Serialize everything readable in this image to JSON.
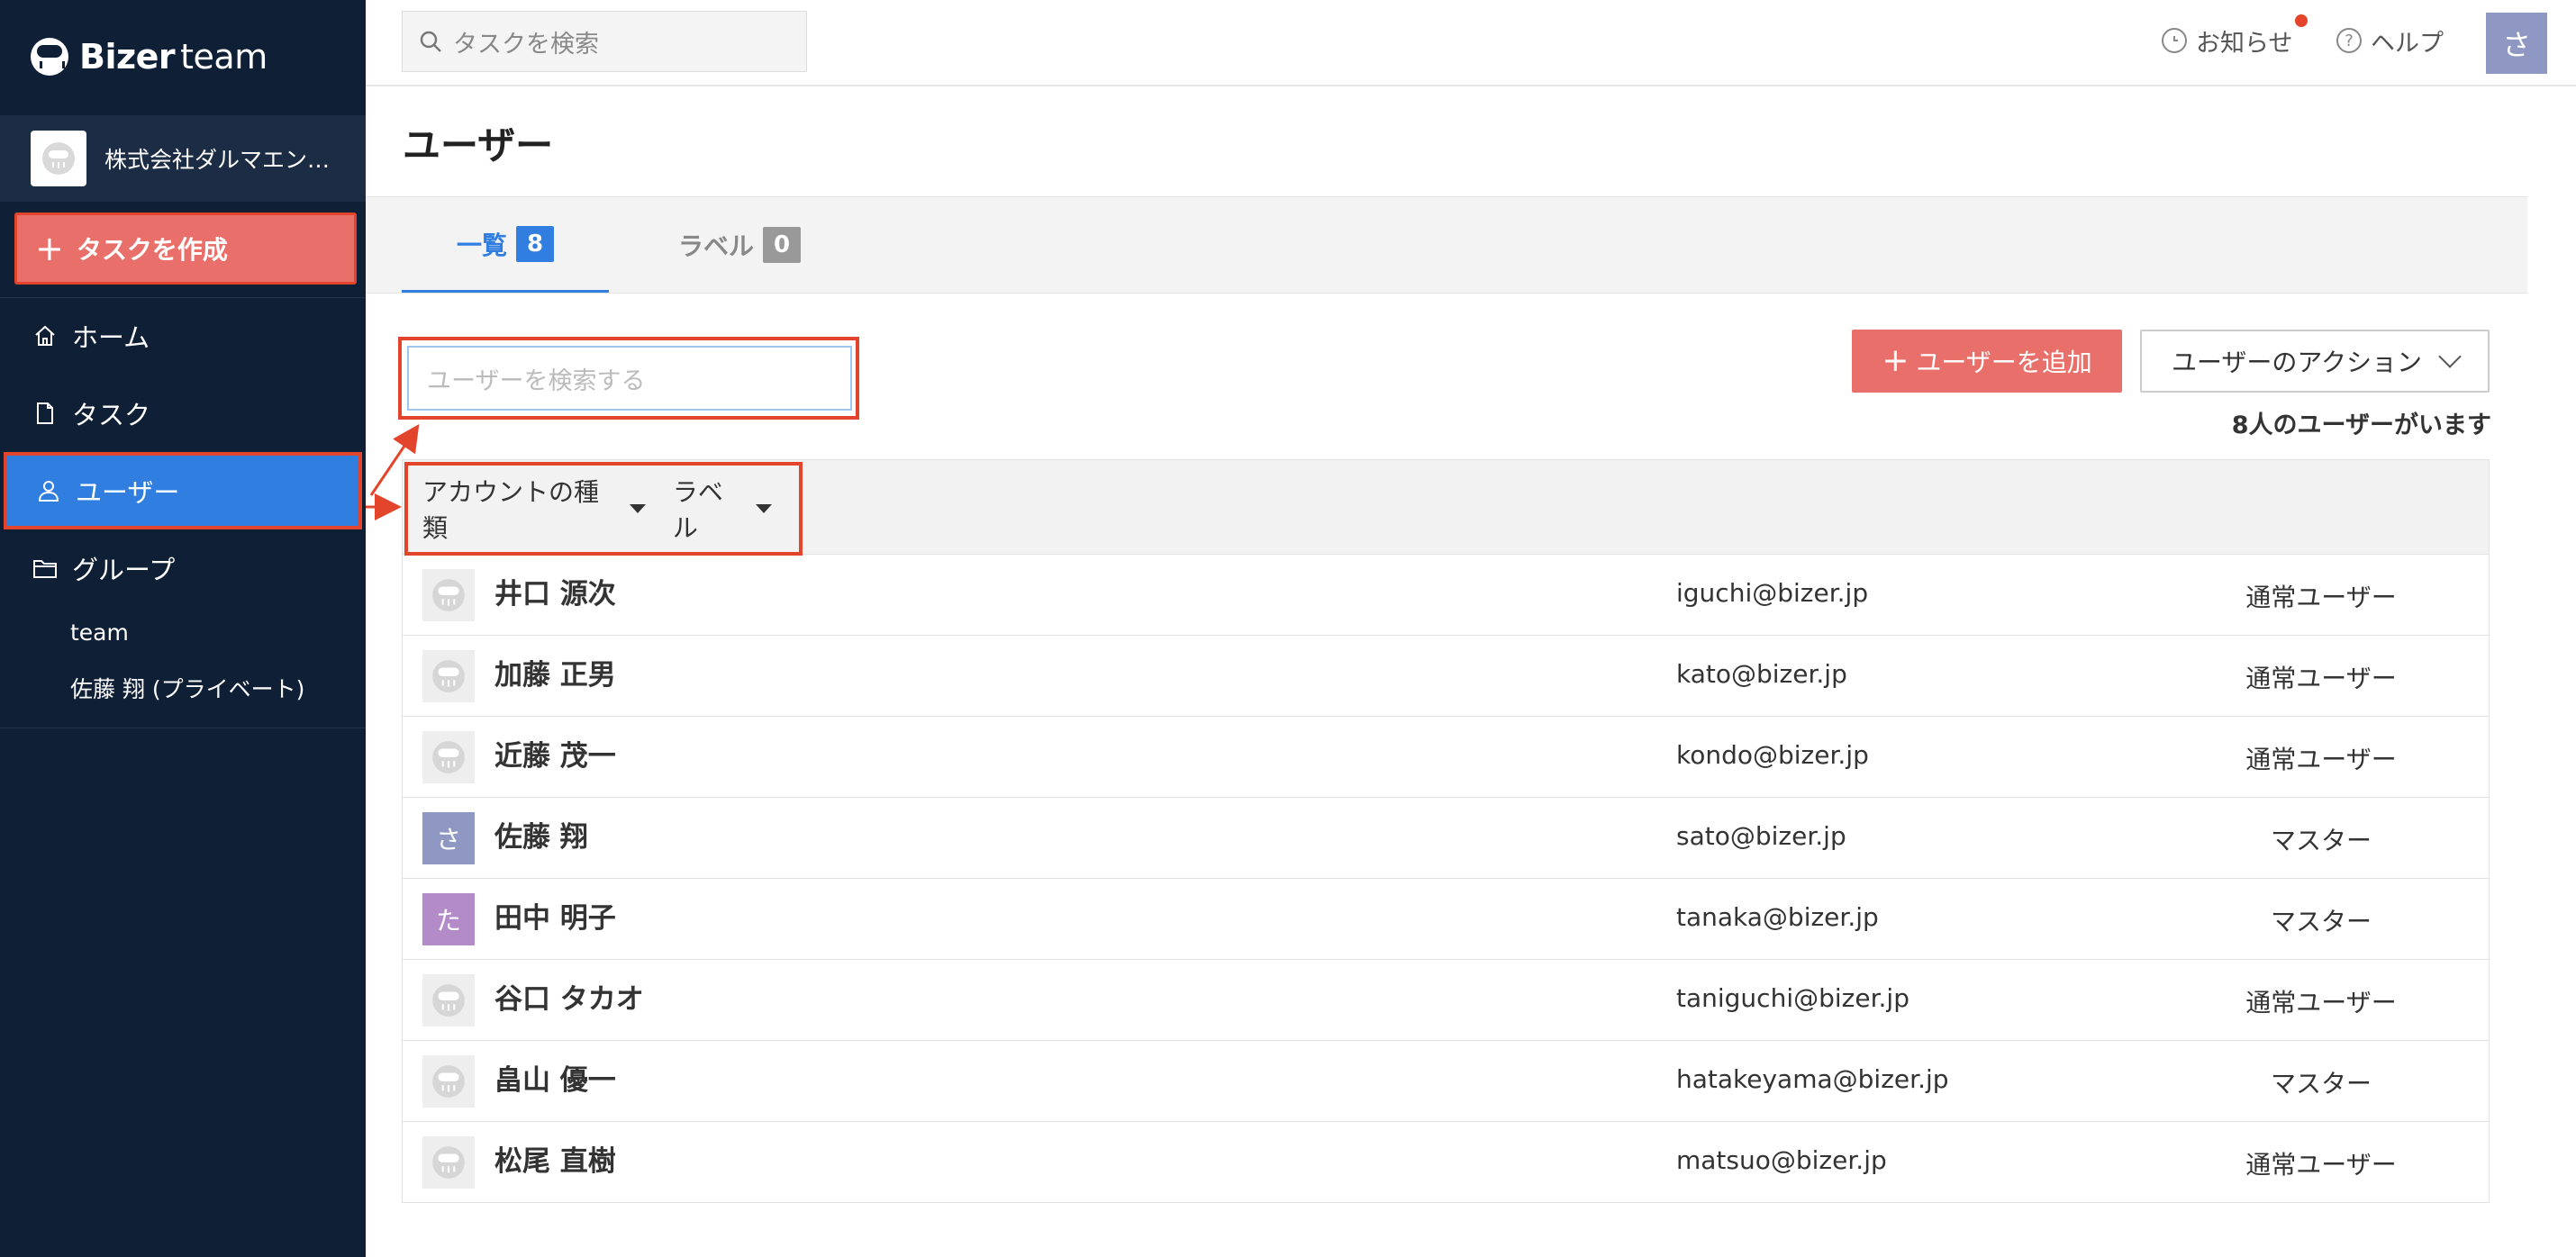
{
  "app": {
    "name": "Bizer",
    "name_suffix": "team"
  },
  "sidebar": {
    "company": "株式会社ダルマエン…",
    "create_task": "タスクを作成",
    "items": [
      {
        "label": "ホーム",
        "icon": "home-icon"
      },
      {
        "label": "タスク",
        "icon": "document-icon"
      },
      {
        "label": "ユーザー",
        "icon": "user-icon",
        "active": true
      },
      {
        "label": "グループ",
        "icon": "folder-icon"
      }
    ],
    "groups": [
      "team",
      "佐藤 翔 (プライベート)"
    ]
  },
  "topbar": {
    "search_placeholder": "タスクを検索",
    "notice": "お知らせ",
    "help": "ヘルプ",
    "avatar": "さ"
  },
  "page": {
    "title": "ユーザー",
    "tabs": [
      {
        "label": "一覧",
        "count": "8",
        "active": true
      },
      {
        "label": "ラベル",
        "count": "0",
        "active": false
      }
    ],
    "search_placeholder": "ユーザーを検索する",
    "add_user": "ユーザーを追加",
    "user_actions": "ユーザーのアクション",
    "user_count": "8人のユーザーがいます",
    "filters": [
      "アカウントの種類",
      "ラベル"
    ]
  },
  "users": [
    {
      "name": "井口 源次",
      "email": "iguchi@bizer.jp",
      "role": "通常ユーザー",
      "avatar": ""
    },
    {
      "name": "加藤 正男",
      "email": "kato@bizer.jp",
      "role": "通常ユーザー",
      "avatar": ""
    },
    {
      "name": "近藤 茂一",
      "email": "kondo@bizer.jp",
      "role": "通常ユーザー",
      "avatar": ""
    },
    {
      "name": "佐藤 翔",
      "email": "sato@bizer.jp",
      "role": "マスター",
      "avatar": "さ",
      "avatar_color": "#8f98c3"
    },
    {
      "name": "田中 明子",
      "email": "tanaka@bizer.jp",
      "role": "マスター",
      "avatar": "た",
      "avatar_color": "#b38bc8"
    },
    {
      "name": "谷口 タカオ",
      "email": "taniguchi@bizer.jp",
      "role": "通常ユーザー",
      "avatar": ""
    },
    {
      "name": "畠山 優一",
      "email": "hatakeyama@bizer.jp",
      "role": "マスター",
      "avatar": ""
    },
    {
      "name": "松尾 直樹",
      "email": "matsuo@bizer.jp",
      "role": "通常ユーザー",
      "avatar": ""
    }
  ],
  "colors": {
    "sidebar_bg": "#0f1f36",
    "accent_blue": "#2f7ee0",
    "accent_red": "#e9706a",
    "highlight_red": "#e2452c"
  }
}
